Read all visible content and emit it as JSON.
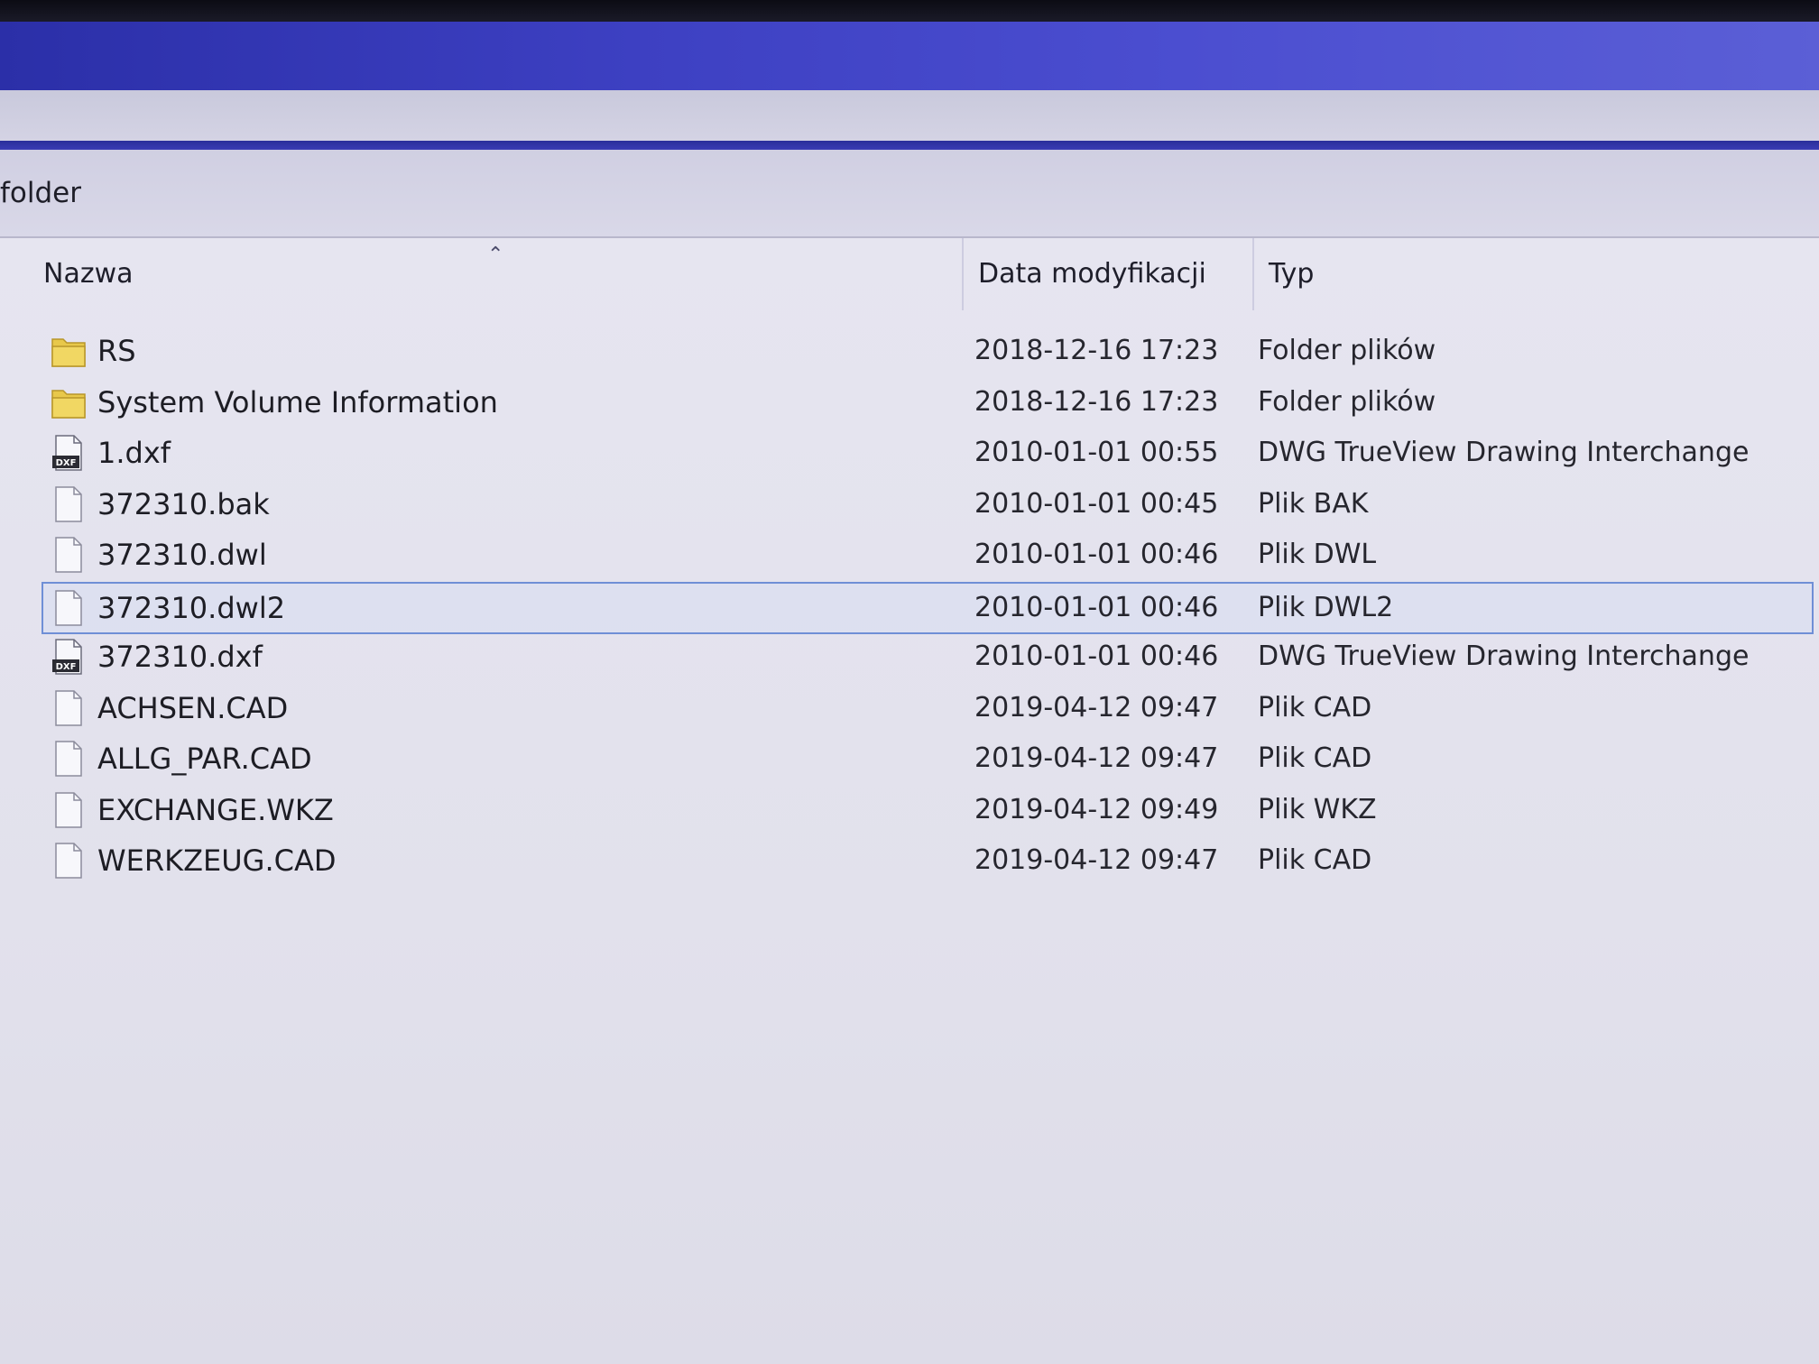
{
  "location": {
    "label": "folder"
  },
  "columns": {
    "name": "Nazwa",
    "date": "Data modyfikacji",
    "type": "Typ"
  },
  "files": [
    {
      "name": "RS",
      "date": "2018-12-16 17:23",
      "type": "Folder plików",
      "icon": "folder-icon"
    },
    {
      "name": "System Volume Information",
      "date": "2018-12-16 17:23",
      "type": "Folder plików",
      "icon": "folder-icon"
    },
    {
      "name": "1.dxf",
      "date": "2010-01-01 00:55",
      "type": "DWG TrueView Drawing Interchange",
      "icon": "dxf-file-icon"
    },
    {
      "name": "372310.bak",
      "date": "2010-01-01 00:45",
      "type": "Plik BAK",
      "icon": "file-icon"
    },
    {
      "name": "372310.dwl",
      "date": "2010-01-01 00:46",
      "type": "Plik DWL",
      "icon": "file-icon"
    },
    {
      "name": "372310.dwl2",
      "date": "2010-01-01 00:46",
      "type": "Plik DWL2",
      "icon": "file-icon"
    },
    {
      "name": "372310.dxf",
      "date": "2010-01-01 00:46",
      "type": "DWG TrueView Drawing Interchange",
      "icon": "dxf-file-icon"
    },
    {
      "name": "ACHSEN.CAD",
      "date": "2019-04-12 09:47",
      "type": "Plik CAD",
      "icon": "file-icon"
    },
    {
      "name": "ALLG_PAR.CAD",
      "date": "2019-04-12 09:47",
      "type": "Plik CAD",
      "icon": "file-icon"
    },
    {
      "name": "EXCHANGE.WKZ",
      "date": "2019-04-12 09:49",
      "type": "Plik WKZ",
      "icon": "file-icon"
    },
    {
      "name": "WERKZEUG.CAD",
      "date": "2019-04-12 09:47",
      "type": "Plik CAD",
      "icon": "file-icon"
    }
  ],
  "dxf_icon_label": "DXF",
  "colors": {
    "folder": "#e8c84a",
    "selection_border": "#6f8fd6",
    "titlebar": "#3d40c2"
  }
}
